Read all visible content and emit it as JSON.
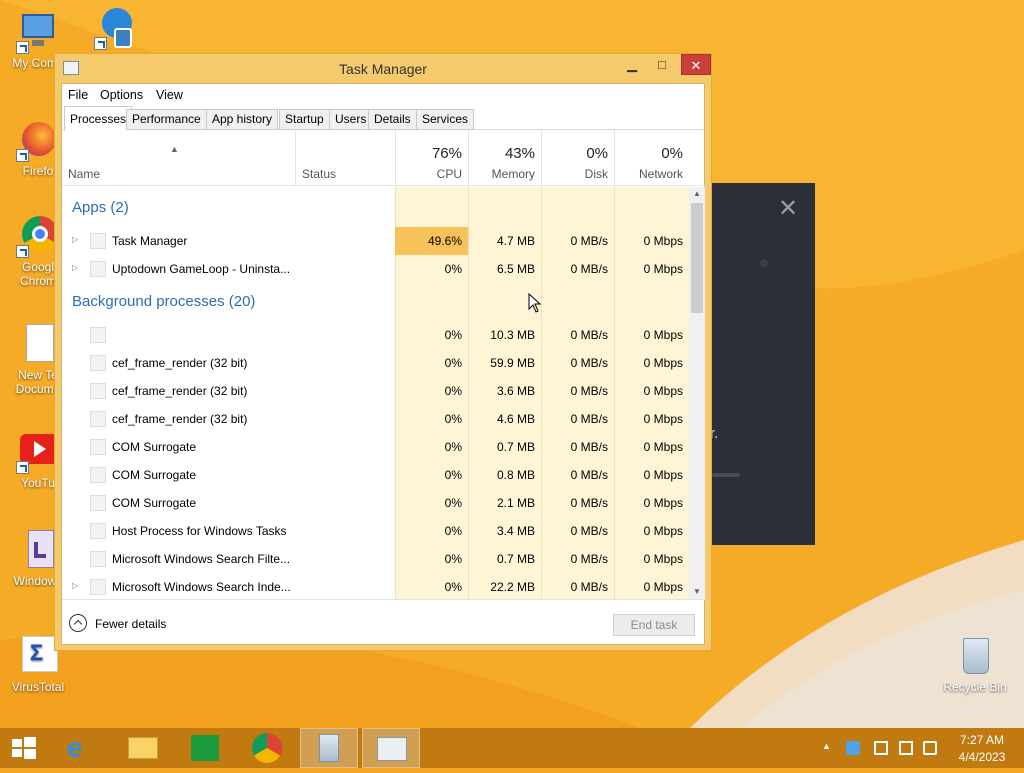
{
  "desktop": {
    "icons": [
      {
        "label": "My Comp",
        "icon": "computer-icon"
      },
      {
        "label": "",
        "icon": "system-tool-icon"
      },
      {
        "label": "Firefo",
        "icon": "firefox-icon"
      },
      {
        "label": "Googl Chrom",
        "icon": "chrome-icon"
      },
      {
        "label": "New Te Docume",
        "icon": "text-document-icon"
      },
      {
        "label": "YouTu",
        "icon": "youtube-icon"
      },
      {
        "label": "Windows",
        "icon": "windows-calendar-icon"
      },
      {
        "label": "VirusTotal",
        "icon": "virustotal-icon"
      },
      {
        "label": "Recycle Bin",
        "icon": "recycle-bin-icon"
      }
    ],
    "dark_panel_text": "r."
  },
  "window": {
    "title": "Task Manager",
    "minimize": "▁",
    "maximize": "□",
    "close": "✕"
  },
  "menu": [
    "File",
    "Options",
    "View"
  ],
  "tabs": [
    "Processes",
    "Performance",
    "App history",
    "Startup",
    "Users",
    "Details",
    "Services"
  ],
  "active_tab": "Processes",
  "columns": {
    "name": "Name",
    "status": "Status",
    "cpu": {
      "pct": "76%",
      "label": "CPU"
    },
    "memory": {
      "pct": "43%",
      "label": "Memory"
    },
    "disk": {
      "pct": "0%",
      "label": "Disk"
    },
    "network": {
      "pct": "0%",
      "label": "Network"
    }
  },
  "groups": {
    "apps": "Apps (2)",
    "background": "Background processes (20)"
  },
  "apps": [
    {
      "name": "Task Manager",
      "cpu": "49.6%",
      "memory": "4.7 MB",
      "disk": "0 MB/s",
      "network": "0 Mbps",
      "expandable": true
    },
    {
      "name": "Uptodown GameLoop - Uninsta...",
      "cpu": "0%",
      "memory": "6.5 MB",
      "disk": "0 MB/s",
      "network": "0 Mbps",
      "expandable": true
    }
  ],
  "background": [
    {
      "name": "",
      "cpu": "0%",
      "memory": "10.3 MB",
      "disk": "0 MB/s",
      "network": "0 Mbps",
      "expandable": false
    },
    {
      "name": "cef_frame_render (32 bit)",
      "cpu": "0%",
      "memory": "59.9 MB",
      "disk": "0 MB/s",
      "network": "0 Mbps",
      "expandable": false
    },
    {
      "name": "cef_frame_render (32 bit)",
      "cpu": "0%",
      "memory": "3.6 MB",
      "disk": "0 MB/s",
      "network": "0 Mbps",
      "expandable": false
    },
    {
      "name": "cef_frame_render (32 bit)",
      "cpu": "0%",
      "memory": "4.6 MB",
      "disk": "0 MB/s",
      "network": "0 Mbps",
      "expandable": false
    },
    {
      "name": "COM Surrogate",
      "cpu": "0%",
      "memory": "0.7 MB",
      "disk": "0 MB/s",
      "network": "0 Mbps",
      "expandable": false
    },
    {
      "name": "COM Surrogate",
      "cpu": "0%",
      "memory": "0.8 MB",
      "disk": "0 MB/s",
      "network": "0 Mbps",
      "expandable": false
    },
    {
      "name": "COM Surrogate",
      "cpu": "0%",
      "memory": "2.1 MB",
      "disk": "0 MB/s",
      "network": "0 Mbps",
      "expandable": false
    },
    {
      "name": "Host Process for Windows Tasks",
      "cpu": "0%",
      "memory": "3.4 MB",
      "disk": "0 MB/s",
      "network": "0 Mbps",
      "expandable": false
    },
    {
      "name": "Microsoft Windows Search Filte...",
      "cpu": "0%",
      "memory": "0.7 MB",
      "disk": "0 MB/s",
      "network": "0 Mbps",
      "expandable": false
    },
    {
      "name": "Microsoft Windows Search Inde...",
      "cpu": "0%",
      "memory": "22.2 MB",
      "disk": "0 MB/s",
      "network": "0 Mbps",
      "expandable": true
    }
  ],
  "footer": {
    "fewer_details": "Fewer details",
    "end_task": "End task"
  },
  "taskbar": {
    "items": [
      "start-icon",
      "internet-explorer-icon",
      "file-explorer-icon",
      "store-icon",
      "chrome-icon",
      "recycle-bin-icon",
      "task-manager-icon"
    ],
    "time": "7:27 AM",
    "date": "4/4/2023"
  },
  "colors": {
    "desktop": "#f5a623",
    "cpu_hot": "#f8c25a",
    "cpu_warm": "#fdf1cf",
    "group_text": "#2a6db5",
    "close_button": "#c7413a"
  }
}
